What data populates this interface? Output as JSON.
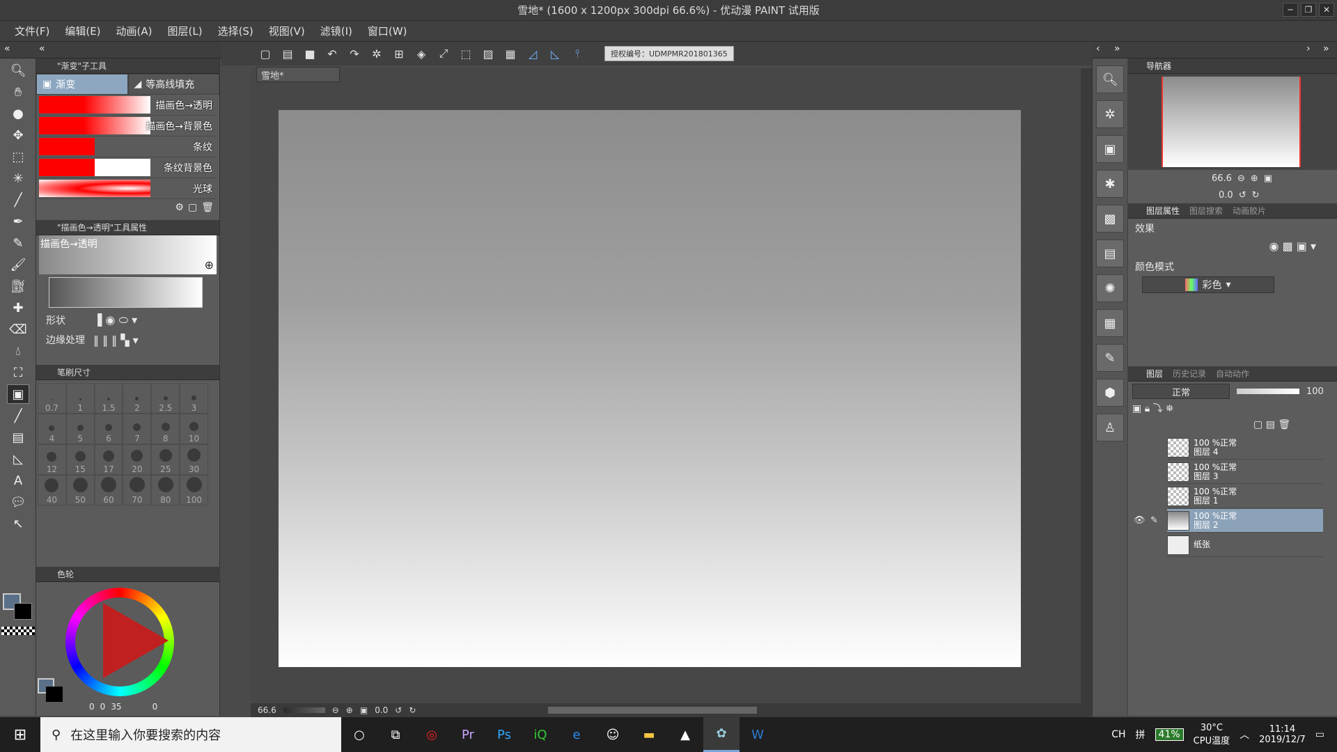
{
  "window": {
    "title": "雪地* (1600 x 1200px 300dpi 66.6%) - 优动漫 PAINT 试用版"
  },
  "menu": [
    "文件(F)",
    "编辑(E)",
    "动画(A)",
    "图层(L)",
    "选择(S)",
    "视图(V)",
    "滤镜(I)",
    "窗口(W)"
  ],
  "subtool_panel": {
    "title": "\"渐变\"子工具",
    "tabs": [
      "渐变",
      "等高线填充"
    ],
    "gradients": [
      {
        "label": "描画色→透明",
        "colors": [
          "#ff0000",
          "#ffffff"
        ]
      },
      {
        "label": "描画色→背景色",
        "colors": [
          "#ff0000",
          "#ffffff"
        ]
      },
      {
        "label": "条纹",
        "colors": [
          "#ff0000",
          "#888888"
        ]
      },
      {
        "label": "条纹背景色",
        "colors": [
          "#ff0000",
          "#ffffff"
        ]
      },
      {
        "label": "光球",
        "colors": [
          "#ffffff",
          "#ff0000"
        ]
      }
    ]
  },
  "props_panel": {
    "title": "\"描画色→透明\"工具属性",
    "name": "描画色→透明",
    "shape_label": "形状",
    "edge_label": "边缘处理"
  },
  "brush_panel": {
    "title": "笔刷尺寸",
    "sizes": [
      "0.7",
      "1",
      "1.5",
      "2",
      "2.5",
      "3",
      "4",
      "5",
      "6",
      "7",
      "8",
      "10",
      "12",
      "15",
      "17",
      "20",
      "25",
      "30",
      "40",
      "50",
      "60",
      "70",
      "80",
      "100"
    ]
  },
  "color_panel": {
    "title": "色轮",
    "h_value": "0",
    "s_value": "0",
    "v_value": "35",
    "extra": "0"
  },
  "toolbar": {
    "license": "授权编号：UDMPMR201801365"
  },
  "document": {
    "tab": "雪地*"
  },
  "status": {
    "zoom": "66.6",
    "angle": "0.0"
  },
  "navigator": {
    "title": "导航器",
    "zoom": "66.6",
    "angle": "0.0"
  },
  "layer_props": {
    "tabs": [
      "图层属性",
      "图层搜索",
      "动画胶片"
    ],
    "effect_label": "效果",
    "color_mode_label": "颜色模式",
    "color_mode_value": "彩色"
  },
  "layers_panel": {
    "tabs": [
      "图层",
      "历史记录",
      "自动动作"
    ],
    "blend": "正常",
    "opacity": "100",
    "layers": [
      {
        "line1": "100 %正常",
        "line2": "图层  4",
        "selected": false,
        "type": "checker"
      },
      {
        "line1": "100 %正常",
        "line2": "图层  3",
        "selected": false,
        "type": "checker"
      },
      {
        "line1": "100 %正常",
        "line2": "图层  1",
        "selected": false,
        "type": "checker"
      },
      {
        "line1": "100 %正常",
        "line2": "图层  2",
        "selected": true,
        "type": "gradient"
      },
      {
        "line1": "纸张",
        "line2": "",
        "selected": false,
        "type": "paper"
      }
    ]
  },
  "taskbar": {
    "search_placeholder": "在这里输入你要搜索的内容",
    "ime": "CH",
    "ime2": "拼",
    "battery": "41%",
    "temp": "30°C",
    "temp_label": "CPU温度",
    "time": "11:14",
    "date": "2019/12/7"
  }
}
